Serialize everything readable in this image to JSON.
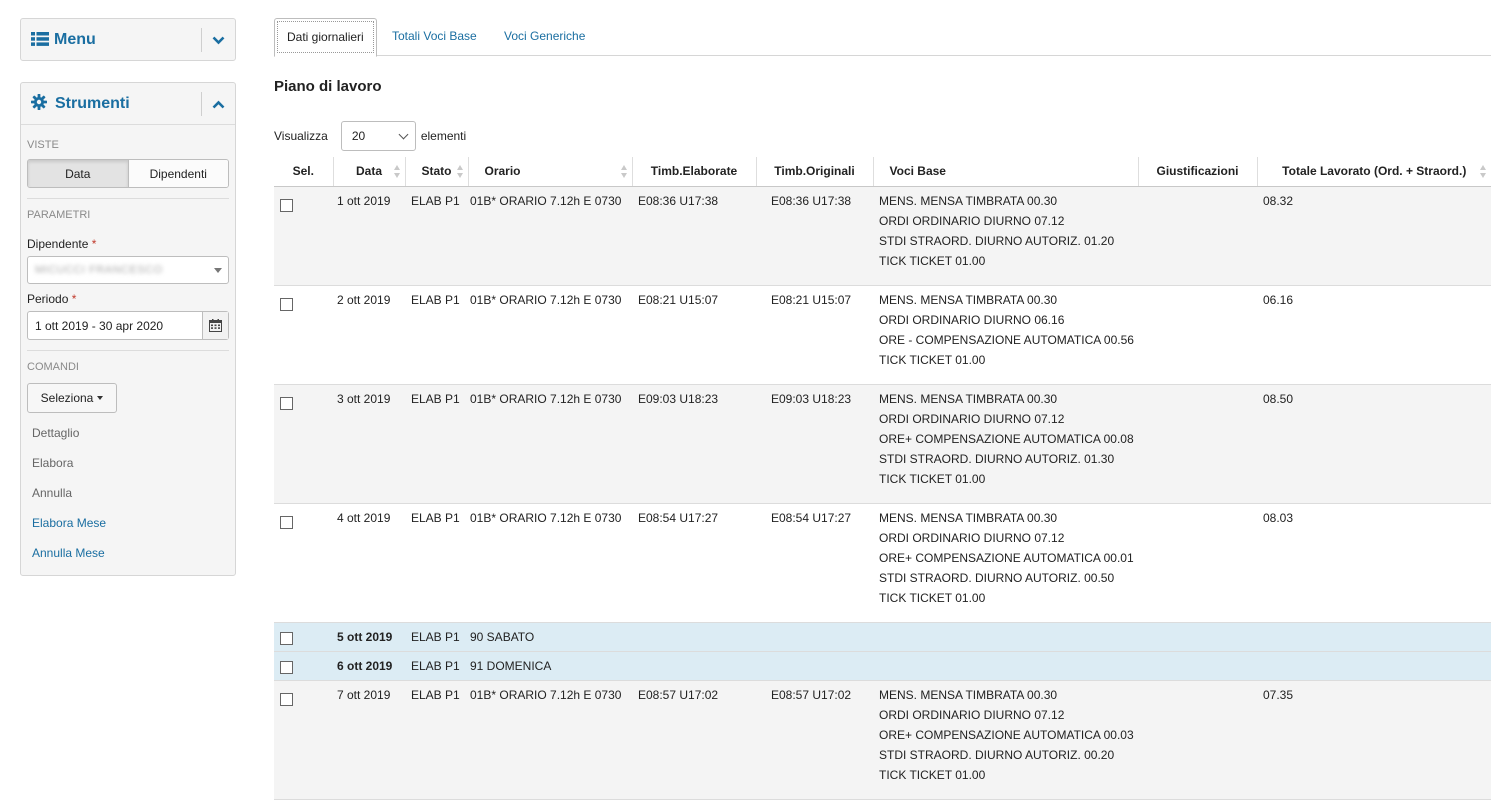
{
  "sidebar": {
    "menu_title": "Menu",
    "tools_title": "Strumenti",
    "viste_label": "VISTE",
    "view_buttons": [
      "Data",
      "Dipendenti"
    ],
    "parametri_label": "PARAMETRI",
    "dipendente_label": "Dipendente",
    "dipendente_value": "MICUCCI FRANCESCO",
    "periodo_label": "Periodo",
    "periodo_value": "1 ott 2019 - 30 apr 2020",
    "comandi_label": "COMANDI",
    "seleziona_label": "Seleziona",
    "commands": [
      "Dettaglio",
      "Elabora",
      "Annulla",
      "Elabora Mese",
      "Annulla Mese"
    ],
    "required_mark": "*"
  },
  "tabs": [
    "Dati giornalieri",
    "Totali Voci Base",
    "Voci Generiche"
  ],
  "page": {
    "title": "Piano di lavoro",
    "show_label": "Visualizza",
    "show_value": "20",
    "elements_label": "elementi"
  },
  "table": {
    "headers": [
      "Sel.",
      "Data",
      "Stato",
      "Orario",
      "Timb.Elaborate",
      "Timb.Originali",
      "Voci Base",
      "Giustificazioni",
      "Totale Lavorato (Ord. + Straord.)"
    ],
    "rows": [
      {
        "data": "1 ott 2019",
        "stato": "ELAB P1",
        "orario": "01B* ORARIO 7.12h E 0730",
        "timb_el": "E08:36 U17:38",
        "timb_or": "E08:36 U17:38",
        "voci": [
          "MENS. MENSA TIMBRATA 00.30",
          "ORDI ORDINARIO DIURNO 07.12",
          "STDI STRAORD. DIURNO AUTORIZ. 01.20",
          "TICK TICKET 01.00"
        ],
        "giust": "",
        "totale": "08.32",
        "weekend": false
      },
      {
        "data": "2 ott 2019",
        "stato": "ELAB P1",
        "orario": "01B* ORARIO 7.12h E 0730",
        "timb_el": "E08:21 U15:07",
        "timb_or": "E08:21 U15:07",
        "voci": [
          "MENS. MENSA TIMBRATA 00.30",
          "ORDI ORDINARIO DIURNO 06.16",
          "ORE - COMPENSAZIONE AUTOMATICA 00.56",
          "TICK TICKET 01.00"
        ],
        "giust": "",
        "totale": "06.16",
        "weekend": false
      },
      {
        "data": "3 ott 2019",
        "stato": "ELAB P1",
        "orario": "01B* ORARIO 7.12h E 0730",
        "timb_el": "E09:03 U18:23",
        "timb_or": "E09:03 U18:23",
        "voci": [
          "MENS. MENSA TIMBRATA 00.30",
          "ORDI ORDINARIO DIURNO 07.12",
          "ORE+ COMPENSAZIONE AUTOMATICA 00.08",
          "STDI STRAORD. DIURNO AUTORIZ. 01.30",
          "TICK TICKET 01.00"
        ],
        "giust": "",
        "totale": "08.50",
        "weekend": false
      },
      {
        "data": "4 ott 2019",
        "stato": "ELAB P1",
        "orario": "01B* ORARIO 7.12h E 0730",
        "timb_el": "E08:54 U17:27",
        "timb_or": "E08:54 U17:27",
        "voci": [
          "MENS. MENSA TIMBRATA 00.30",
          "ORDI ORDINARIO DIURNO 07.12",
          "ORE+ COMPENSAZIONE AUTOMATICA 00.01",
          "STDI STRAORD. DIURNO AUTORIZ. 00.50",
          "TICK TICKET 01.00"
        ],
        "giust": "",
        "totale": "08.03",
        "weekend": false
      },
      {
        "data": "5 ott 2019",
        "stato": "ELAB P1",
        "orario": "90 SABATO",
        "timb_el": "",
        "timb_or": "",
        "voci": [],
        "giust": "",
        "totale": "",
        "weekend": true
      },
      {
        "data": "6 ott 2019",
        "stato": "ELAB P1",
        "orario": "91 DOMENICA",
        "timb_el": "",
        "timb_or": "",
        "voci": [],
        "giust": "",
        "totale": "",
        "weekend": true
      },
      {
        "data": "7 ott 2019",
        "stato": "ELAB P1",
        "orario": "01B* ORARIO 7.12h E 0730",
        "timb_el": "E08:57 U17:02",
        "timb_or": "E08:57 U17:02",
        "voci": [
          "MENS. MENSA TIMBRATA 00.30",
          "ORDI ORDINARIO DIURNO 07.12",
          "ORE+ COMPENSAZIONE AUTOMATICA 00.03",
          "STDI STRAORD. DIURNO AUTORIZ. 00.20",
          "TICK TICKET 01.00"
        ],
        "giust": "",
        "totale": "07.35",
        "weekend": false
      }
    ]
  },
  "colors": {
    "accent": "#1a6ea1",
    "weekend_row": "#dcecf4",
    "odd_row": "#f4f4f4"
  }
}
